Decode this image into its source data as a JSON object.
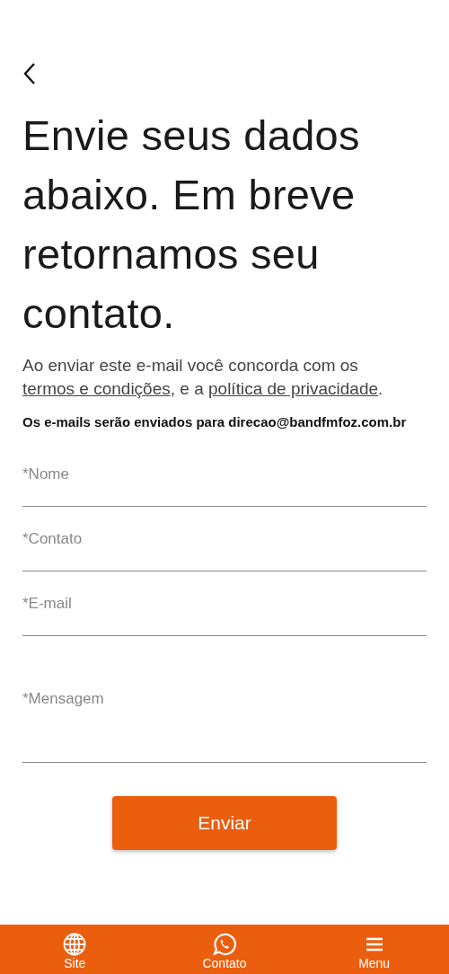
{
  "title": "Envie seus dados abaixo. Em breve retornamos seu contato.",
  "consent": [
    {
      "kind": "text",
      "text": "Ao enviar este e-mail você concorda com os "
    },
    {
      "kind": "link",
      "text": "termos e condições"
    },
    {
      "kind": "text",
      "text": ", e a "
    },
    {
      "kind": "link",
      "text": "política de privacidade"
    },
    {
      "kind": "text",
      "text": "."
    }
  ],
  "recipient_note": "Os e-mails serão enviados para direcao@bandfmfoz.com.br",
  "fields": [
    {
      "placeholder": "*Nome",
      "kind": "line"
    },
    {
      "placeholder": "*Contato",
      "kind": "line"
    },
    {
      "placeholder": "*E-mail",
      "kind": "line"
    },
    {
      "placeholder": "*Mensagem",
      "kind": "area"
    }
  ],
  "submit_button": "Enviar",
  "bottom_nav": [
    {
      "kind": "globe",
      "label": "Site"
    },
    {
      "kind": "chat",
      "label": "Contato"
    },
    {
      "kind": "menu",
      "label": "Menu"
    }
  ]
}
